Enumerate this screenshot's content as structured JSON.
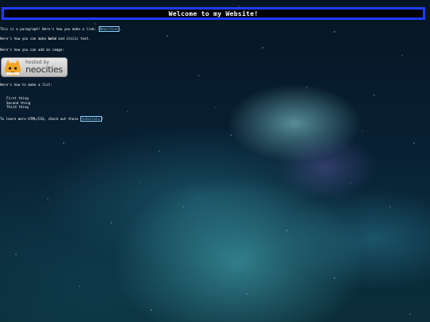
{
  "header": {
    "title": "Welcome to my Website!"
  },
  "intro": {
    "paragraph_text": "This is a paragraph! Here's how you make a link:",
    "paragraph_link": "Neocities",
    "paragraph_end": ".",
    "bold_text_pre": "Here's how you can make",
    "bold_word": "bold",
    "bold_text_mid": "and",
    "italic_word": "italic",
    "bold_text_end": "text.",
    "image_text": "Here's how you can add an image:"
  },
  "badge": {
    "small": "hosted by",
    "big": "neocities"
  },
  "list_section": {
    "intro": "Here's how to make a list:",
    "items": [
      "First thing",
      "Second thing",
      "Third thing"
    ]
  },
  "footer": {
    "text": "To learn more HTML/CSS, check out these",
    "link": "tutorials",
    "end": "!"
  },
  "colors": {
    "header_border": "#1f3cff",
    "link": "#8fd3ff"
  }
}
